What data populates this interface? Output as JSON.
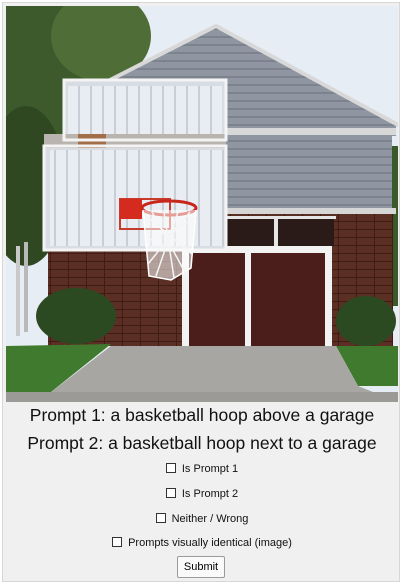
{
  "prompts": {
    "prompt1": "Prompt 1: a basketball hoop above a garage",
    "prompt2": "Prompt 2: a basketball hoop next to a garage"
  },
  "options": {
    "is_prompt_1": "Is Prompt 1",
    "is_prompt_2": "Is Prompt 2",
    "neither": "Neither / Wrong",
    "identical": "Prompts visually identical (image)"
  },
  "buttons": {
    "submit": "Submit"
  },
  "colors": {
    "background": "#f0f0f0",
    "siding": "#8e94a0",
    "brick": "#5a2e22",
    "garage_door": "#4a1d1a",
    "rim": "#d52a1e"
  }
}
